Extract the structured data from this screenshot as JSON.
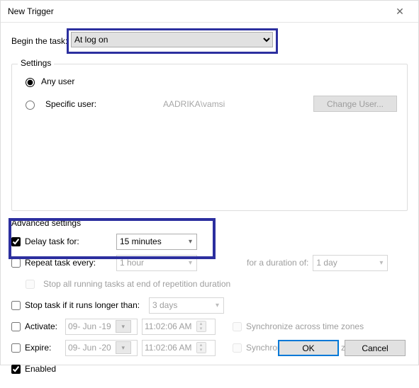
{
  "dialog": {
    "title": "New Trigger",
    "begin_label": "Begin the task:",
    "begin_value": "At log on"
  },
  "settings": {
    "legend": "Settings",
    "any_user": "Any user",
    "specific_user": "Specific user:",
    "user_value": "AADRIKA\\vamsi",
    "change_user": "Change User..."
  },
  "advanced": {
    "legend": "Advanced settings",
    "delay_label": "Delay task for:",
    "delay_value": "15 minutes",
    "repeat_label": "Repeat task every:",
    "repeat_value": "1 hour",
    "repeat_duration_label": "for a duration of:",
    "repeat_duration_value": "1 day",
    "stop_repetition": "Stop all running tasks at end of repetition duration",
    "stop_longer_label": "Stop task if it runs longer than:",
    "stop_longer_value": "3 days",
    "activate_label": "Activate:",
    "activate_date": "09- Jun -19",
    "activate_time": "11:02:06 AM",
    "expire_label": "Expire:",
    "expire_date": "09- Jun -20",
    "expire_time": "11:02:06 AM",
    "sync_tz": "Synchronize across time zones",
    "enabled": "Enabled"
  },
  "buttons": {
    "ok": "OK",
    "cancel": "Cancel"
  }
}
